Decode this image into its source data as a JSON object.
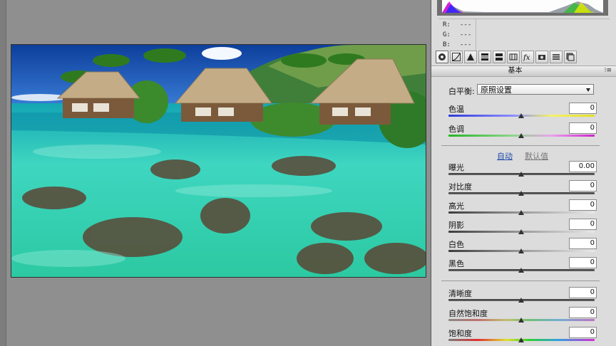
{
  "rgb_readout": [
    {
      "channel": "R:",
      "value": "---"
    },
    {
      "channel": "G:",
      "value": "---"
    },
    {
      "channel": "B:",
      "value": "---"
    }
  ],
  "toolbar_icons": [
    "aperture-icon",
    "tone-curve-icon",
    "detail-icon",
    "hsl-icon",
    "split-tone-icon",
    "lens-icon",
    "fx-icon",
    "camera-icon",
    "presets-icon",
    "snapshots-icon"
  ],
  "section": {
    "title": "基本",
    "menu_glyph": "⁝≡"
  },
  "white_balance": {
    "label": "白平衡:",
    "value": "原照设置"
  },
  "sliders_wb": [
    {
      "name": "temperature",
      "label": "色温",
      "value": "0",
      "track": "temp"
    },
    {
      "name": "tint",
      "label": "色调",
      "value": "0",
      "track": "tint"
    }
  ],
  "tone_links": {
    "auto": "自动",
    "default": "默认值"
  },
  "sliders_tone": [
    {
      "name": "exposure",
      "label": "曝光",
      "value": "0.00"
    },
    {
      "name": "contrast",
      "label": "对比度",
      "value": "0"
    },
    {
      "name": "highlights",
      "label": "高光",
      "value": "0"
    },
    {
      "name": "shadows",
      "label": "阴影",
      "value": "0"
    },
    {
      "name": "whites",
      "label": "白色",
      "value": "0"
    },
    {
      "name": "blacks",
      "label": "黑色",
      "value": "0"
    }
  ],
  "sliders_presence": [
    {
      "name": "clarity",
      "label": "清晰度",
      "value": "0"
    },
    {
      "name": "vibrance",
      "label": "自然饱和度",
      "value": "0"
    },
    {
      "name": "saturation",
      "label": "饱和度",
      "value": "0"
    }
  ],
  "colors": {
    "background": "#8f8f8f",
    "panel": "#dcdcdc",
    "link": "#1d4aa7"
  }
}
